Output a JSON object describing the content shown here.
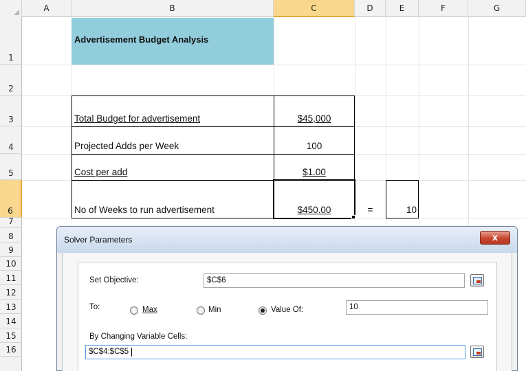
{
  "columns": [
    "A",
    "B",
    "C",
    "D",
    "E",
    "F",
    "G"
  ],
  "rows": [
    "1",
    "2",
    "3",
    "4",
    "5",
    "6",
    "7",
    "8",
    "9",
    "10",
    "11",
    "12",
    "13",
    "14",
    "15",
    "16"
  ],
  "selected_column": "C",
  "selected_row": "6",
  "sheet": {
    "title": "Advertisement Budget Analysis",
    "title_fill_color": "#92cddc",
    "rows": [
      {
        "label": "Total Budget for advertisement",
        "value": "$45,000"
      },
      {
        "label": "Projected Adds per Week",
        "value": "100"
      },
      {
        "label": "Cost per add",
        "value": "$1.00"
      },
      {
        "label": "No of Weeks to run advertisement",
        "value": "$450.00",
        "equals": "=",
        "result": "10"
      }
    ]
  },
  "dialog": {
    "title": "Solver Parameters",
    "close_symbol": "x",
    "set_objective_label": "Set Objective:",
    "set_objective_value": "$C$6",
    "to_label": "To:",
    "options": {
      "max": "Max",
      "min": "Min",
      "value_of": "Value Of:"
    },
    "selected_option": "value_of",
    "value_of_value": "10",
    "changing_cells_label": "By Changing Variable Cells:",
    "changing_cells_value": "$C$4:$C$5"
  }
}
